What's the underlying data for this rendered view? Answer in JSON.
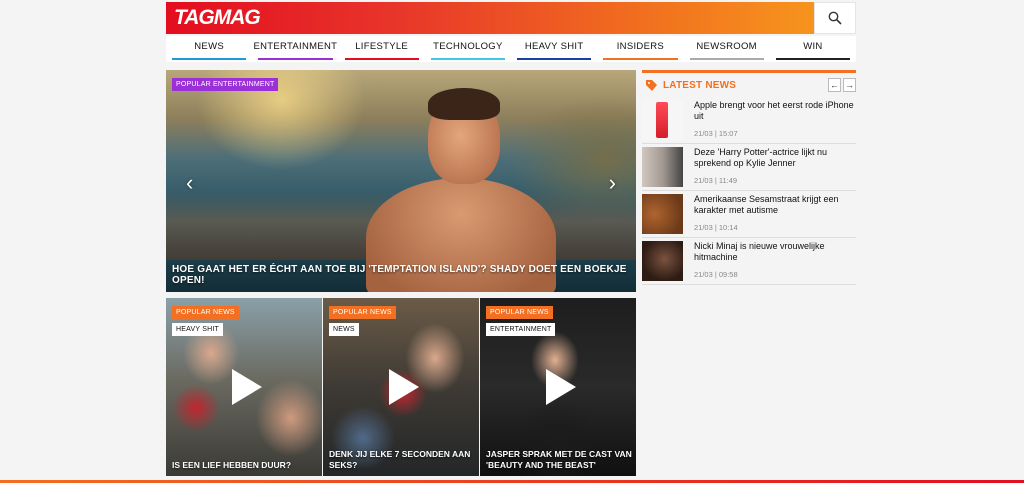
{
  "brand": {
    "logo": "TAGMAG"
  },
  "nav": [
    {
      "label": "NEWS",
      "color": "#1f9ad6"
    },
    {
      "label": "ENTERTAINMENT",
      "color": "#9b30d9"
    },
    {
      "label": "LIFESTYLE",
      "color": "#e30d20"
    },
    {
      "label": "TECHNOLOGY",
      "color": "#44c6e0"
    },
    {
      "label": "HEAVY SHIT",
      "color": "#1d3f9e"
    },
    {
      "label": "INSIDERS",
      "color": "#f36f21"
    },
    {
      "label": "NEWSROOM",
      "color": "#aaaaaa"
    },
    {
      "label": "WIN",
      "color": "#222222"
    }
  ],
  "hero": {
    "tag": "POPULAR ENTERTAINMENT",
    "title": "HOE GAAT HET ER ÉCHT AAN TOE BIJ 'TEMPTATION ISLAND'? SHADY DOET EEN BOEKJE OPEN!",
    "prev_icon": "chevron-left-icon",
    "next_icon": "chevron-right-icon"
  },
  "cards": [
    {
      "tag": "POPULAR NEWS",
      "category": "HEAVY SHIT",
      "title": "IS EEN LIEF HEBBEN DUUR?"
    },
    {
      "tag": "POPULAR NEWS",
      "category": "NEWS",
      "title": "DENK JIJ ELKE 7 SECONDEN AAN SEKS?"
    },
    {
      "tag": "POPULAR NEWS",
      "category": "ENTERTAINMENT",
      "title": "JASPER SPRAK MET DE CAST VAN 'BEAUTY AND THE BEAST'"
    }
  ],
  "sidebar": {
    "title": "LATEST NEWS",
    "accent": "#f36f21",
    "items": [
      {
        "title": "Apple brengt voor het eerst rode iPhone uit",
        "date": "21/03 | 15:07"
      },
      {
        "title": "Deze 'Harry Potter'-actrice lijkt nu sprekend op Kylie Jenner",
        "date": "21/03 | 11:49"
      },
      {
        "title": "Amerikaanse Sesamstraat krijgt een karakter met autisme",
        "date": "21/03 | 10:14"
      },
      {
        "title": "Nicki Minaj is nieuwe vrouwelijke hitmachine",
        "date": "21/03 | 09:58"
      }
    ]
  }
}
